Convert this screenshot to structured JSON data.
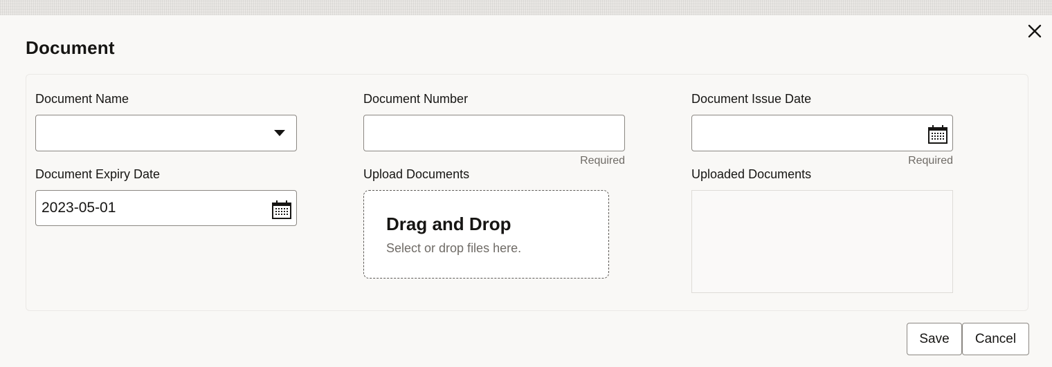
{
  "dialog": {
    "title": "Document",
    "close_icon": "close-icon"
  },
  "form": {
    "document_name": {
      "label": "Document Name",
      "value": "",
      "icon": "chevron-down-icon"
    },
    "document_number": {
      "label": "Document Number",
      "value": "",
      "helper": "Required"
    },
    "document_issue_date": {
      "label": "Document Issue Date",
      "value": "",
      "helper": "Required",
      "icon": "calendar-icon"
    },
    "document_expiry_date": {
      "label": "Document Expiry Date",
      "value": "2023-05-01",
      "icon": "calendar-icon"
    },
    "upload_documents": {
      "label": "Upload Documents",
      "title": "Drag and Drop",
      "subtitle": "Select or drop files here."
    },
    "uploaded_documents": {
      "label": "Uploaded Documents",
      "items": []
    }
  },
  "actions": {
    "save_label": "Save",
    "cancel_label": "Cancel"
  },
  "colors": {
    "background": "#f9f8f6",
    "border": "#8b8782",
    "text": "#161513",
    "muted_text": "#6f6b66"
  }
}
